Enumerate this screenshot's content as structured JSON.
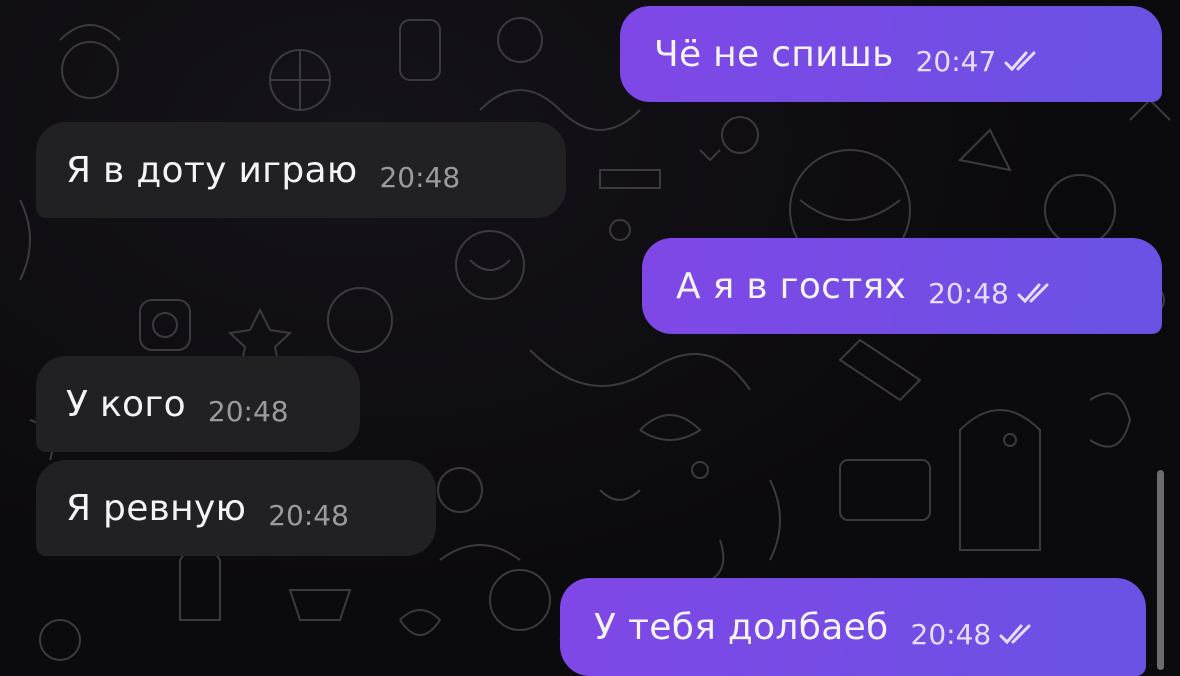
{
  "messages": [
    {
      "direction": "out",
      "text": "Чё не спишь",
      "time": "20:47",
      "status": "read"
    },
    {
      "direction": "in",
      "text": "Я в доту играю",
      "time": "20:48"
    },
    {
      "direction": "out",
      "text": "А я в гостях",
      "time": "20:48",
      "status": "read"
    },
    {
      "direction": "in",
      "text": "У кого",
      "time": "20:48"
    },
    {
      "direction": "in",
      "text": "Я ревную",
      "time": "20:48"
    },
    {
      "direction": "out",
      "text": "У тебя долбаеб",
      "time": "20:48",
      "status": "read"
    }
  ],
  "colors": {
    "background": "#0b0a0d",
    "incoming_bubble": "#212124",
    "outgoing_bubble_start": "#7f47e6",
    "outgoing_bubble_end": "#6a52e4",
    "doodle_stroke": "#3b3a40"
  },
  "icons": {
    "read_status": "double-check-icon"
  }
}
